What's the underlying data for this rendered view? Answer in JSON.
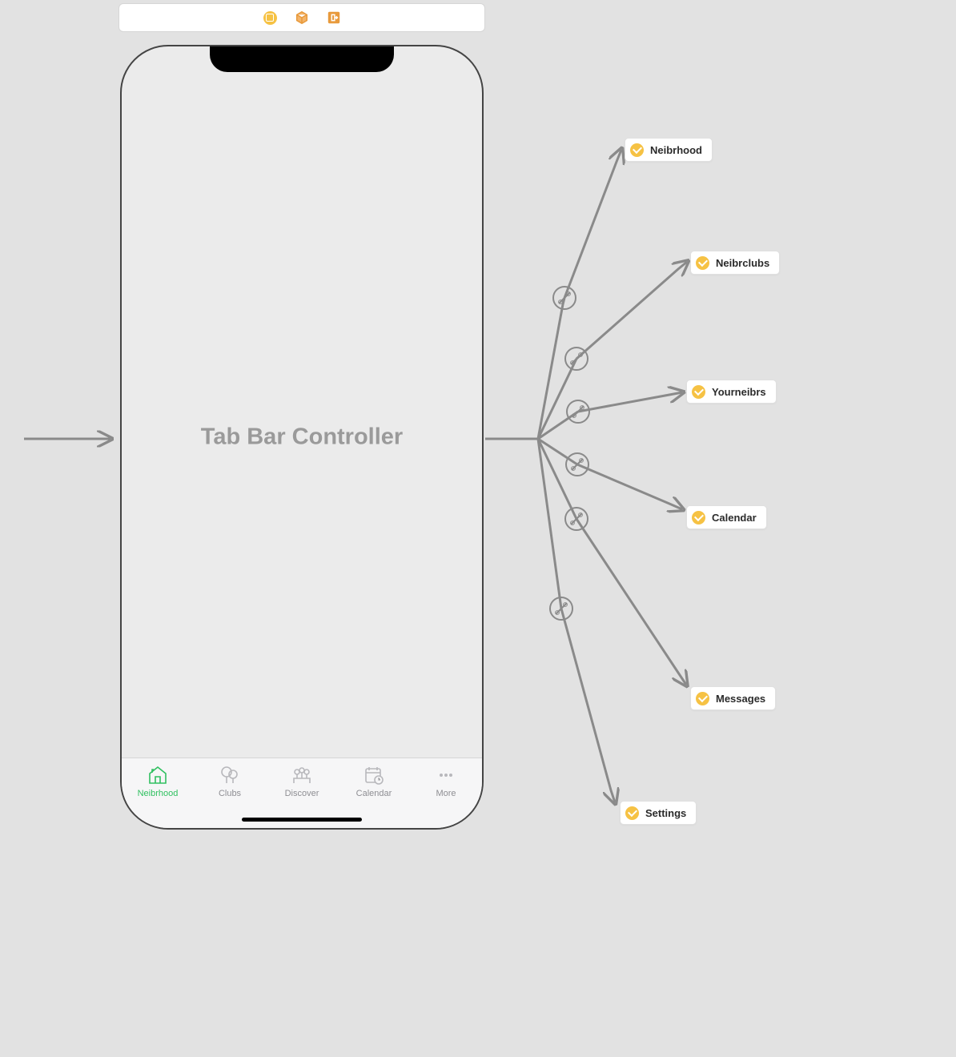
{
  "toolbar": {
    "icons": [
      "scene-icon",
      "object-icon",
      "exit-icon"
    ]
  },
  "phone": {
    "title": "Tab Bar Controller",
    "tabs": [
      {
        "label": "Neibrhood",
        "icon": "house-icon",
        "active": true
      },
      {
        "label": "Clubs",
        "icon": "tree-icon",
        "active": false
      },
      {
        "label": "Discover",
        "icon": "people-icon",
        "active": false
      },
      {
        "label": "Calendar",
        "icon": "calendar-icon",
        "active": false
      },
      {
        "label": "More",
        "icon": "more-icon",
        "active": false
      }
    ]
  },
  "destinations": [
    {
      "label": "Neibrhood"
    },
    {
      "label": "Neibrclubs"
    },
    {
      "label": "Yourneibrs"
    },
    {
      "label": "Calendar"
    },
    {
      "label": "Messages"
    },
    {
      "label": "Settings"
    }
  ]
}
